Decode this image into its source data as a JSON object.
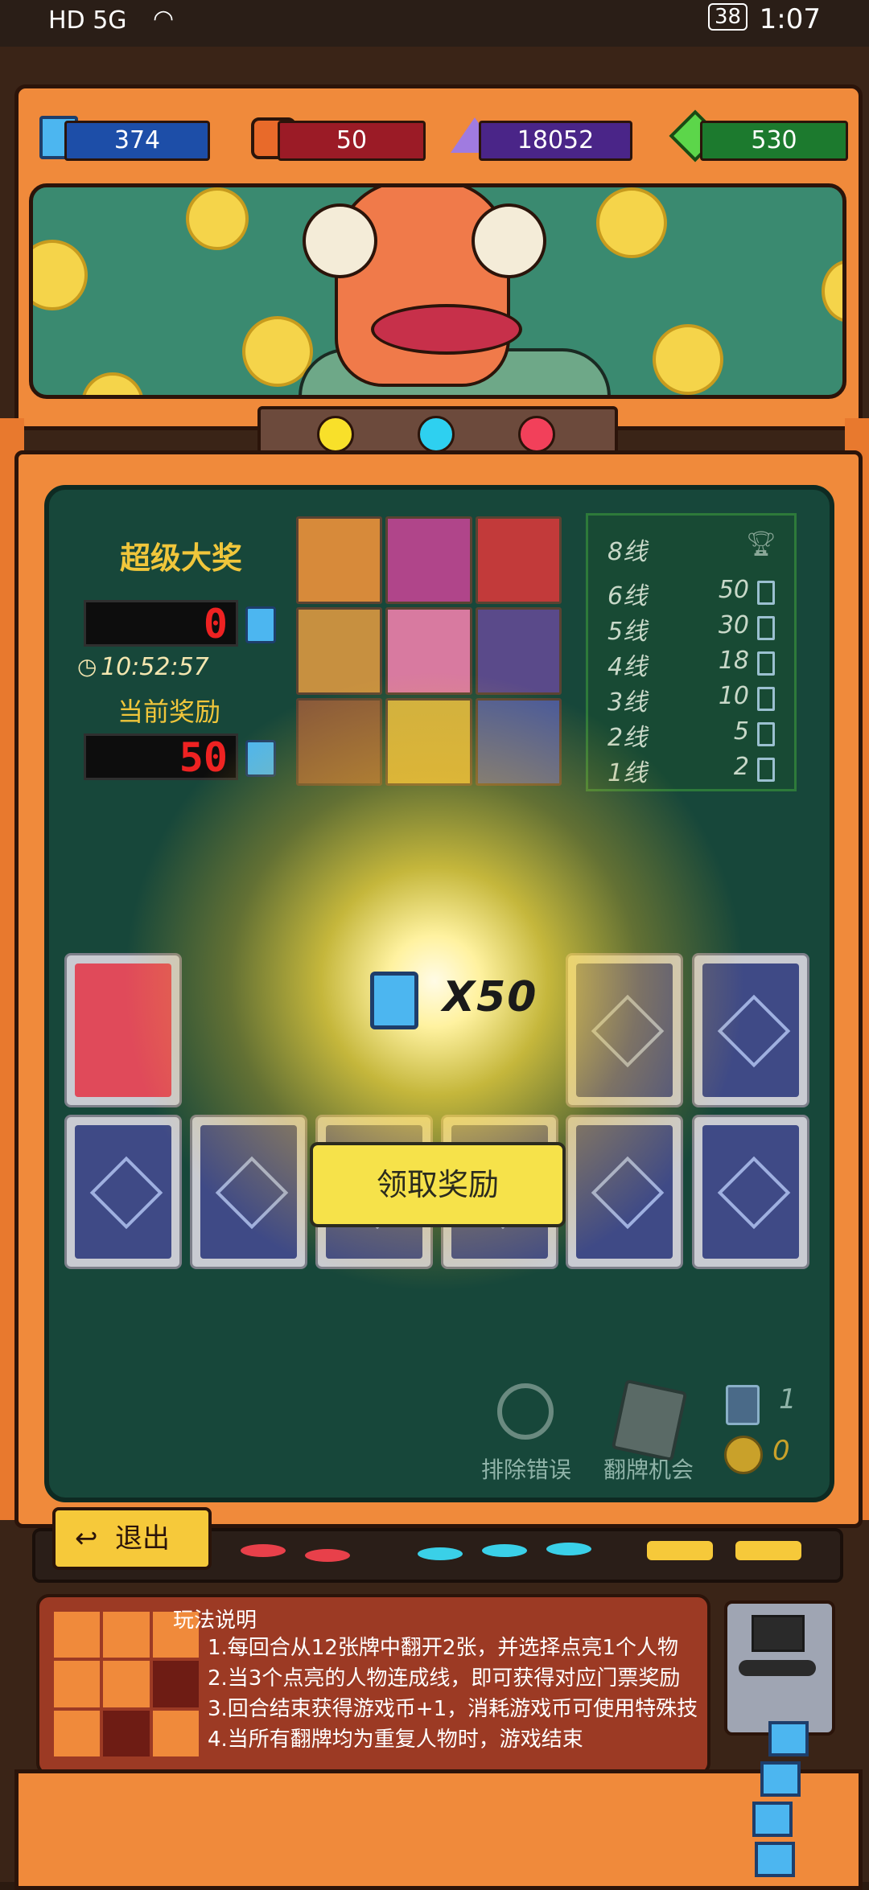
{
  "status_bar": {
    "left_text": "HD 5G",
    "time": "1:07",
    "battery": "38"
  },
  "resources": {
    "tickets": {
      "value": "374",
      "icon": "ticket-icon"
    },
    "ore": {
      "value": "50",
      "icon": "ore-icon"
    },
    "crystal": {
      "value": "18052",
      "icon": "crystal-icon"
    },
    "gem": {
      "value": "530",
      "icon": "gem-icon"
    }
  },
  "jackpot": {
    "title": "超级大奖",
    "led_value": "0",
    "timer": "10:52:57",
    "current_reward_label": "当前奖励",
    "current_reward_value": "50"
  },
  "payout_table": {
    "rows": [
      {
        "line": "8线",
        "reward": ""
      },
      {
        "line": "6线",
        "reward": "50"
      },
      {
        "line": "5线",
        "reward": "30"
      },
      {
        "line": "4线",
        "reward": "18"
      },
      {
        "line": "3线",
        "reward": "10"
      },
      {
        "line": "2线",
        "reward": "5"
      },
      {
        "line": "1线",
        "reward": "2"
      }
    ]
  },
  "reward_popup": {
    "amount": "X50",
    "claim_label": "领取奖励"
  },
  "tools": {
    "eliminate_label": "排除错误",
    "flip_label": "翻牌机会",
    "ticket_count": "1",
    "coin_count": "0"
  },
  "exit_label": "退出",
  "instructions": {
    "title": "玩法说明",
    "lines": [
      "1.每回合从12张牌中翻开2张，并选择点亮1个人物",
      "2.当3个点亮的人物连成线，即可获得对应门票奖励",
      "3.回合结束获得游戏币+1，消耗游戏币可使用特殊技",
      "4.当所有翻牌均为重复人物时，游戏结束"
    ]
  },
  "colors": {
    "ticket_blue": "#1d4ea8",
    "ore_red": "#9b1b26",
    "crystal_purple": "#4a2588",
    "gem_green": "#1c7a2e",
    "claim_yellow": "#f6e24a"
  }
}
